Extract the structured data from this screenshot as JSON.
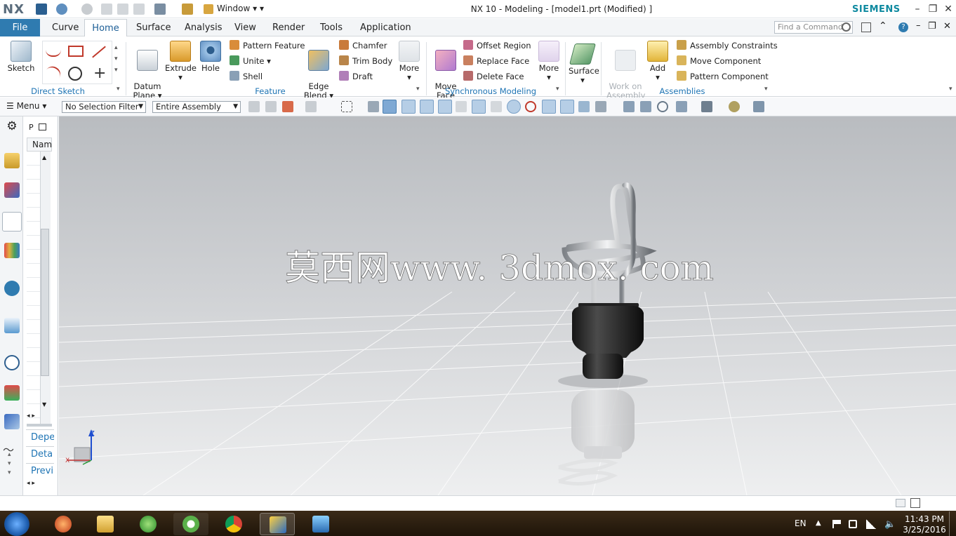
{
  "app": {
    "logo": "NX",
    "window_menu": "Window",
    "title": "NX 10 - Modeling - [model1.prt (Modified) ]",
    "brand": "SIEMENS"
  },
  "tabs": [
    "File",
    "Curve",
    "Home",
    "Surface",
    "Analysis",
    "View",
    "Render",
    "Tools",
    "Application"
  ],
  "active_tab": "Home",
  "find_command": {
    "placeholder": "Find a Command"
  },
  "ribbon": {
    "direct_sketch": {
      "sketch": "Sketch",
      "label": "Direct Sketch"
    },
    "feature": {
      "datum_plane": "Datum\nPlane",
      "extrude": "Extrude",
      "hole": "Hole",
      "pattern_feature": "Pattern Feature",
      "unite": "Unite",
      "shell": "Shell",
      "edge_blend": "Edge\nBlend",
      "chamfer": "Chamfer",
      "trim_body": "Trim Body",
      "draft": "Draft",
      "more": "More",
      "label": "Feature"
    },
    "sync": {
      "move_face": "Move\nFace",
      "offset_region": "Offset Region",
      "replace_face": "Replace Face",
      "delete_face": "Delete Face",
      "more": "More",
      "label": "Synchronous Modeling"
    },
    "surface": {
      "surface": "Surface"
    },
    "assemblies": {
      "work_on_assembly": "Work on\nAssembly",
      "add": "Add",
      "assembly_constraints": "Assembly Constraints",
      "move_component": "Move Component",
      "pattern_component": "Pattern Component",
      "label": "Assemblies"
    }
  },
  "cmdbar": {
    "menu": "Menu",
    "selection_filter": "No Selection Filter",
    "scope": "Entire Assembly"
  },
  "navpanel": {
    "header_p": "P",
    "column": "Nam",
    "sections": [
      "Depe",
      "Deta",
      "Previ"
    ]
  },
  "watermark": "莫西网www. 3dmox. com",
  "triad": {
    "z": "Z",
    "x": "X"
  },
  "taskbar": {
    "lang": "EN",
    "time": "11:43 PM",
    "date": "3/25/2016"
  }
}
